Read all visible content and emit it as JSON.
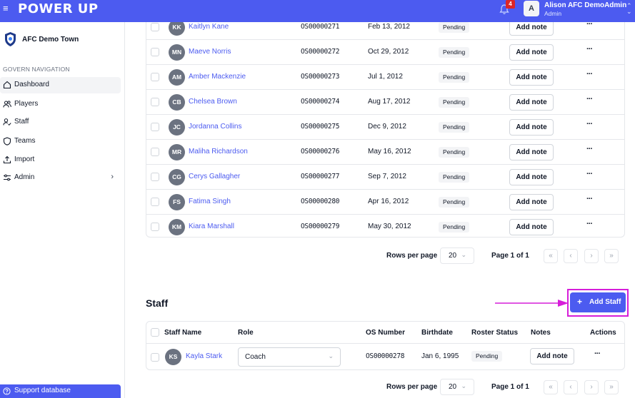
{
  "topbar": {
    "brand": "POWER UP",
    "notification_count": "4",
    "avatar_initial": "A",
    "user_name": "Alison AFC DemoAdmin",
    "user_role": "Admin"
  },
  "sidebar": {
    "org_name": "AFC Demo Town",
    "nav_heading": "GOVERN NAVIGATION",
    "items": [
      {
        "label": "Dashboard",
        "icon": "home-icon",
        "active": true
      },
      {
        "label": "Players",
        "icon": "users-icon"
      },
      {
        "label": "Staff",
        "icon": "user-check-icon"
      },
      {
        "label": "Teams",
        "icon": "shield-icon"
      },
      {
        "label": "Import",
        "icon": "upload-icon"
      },
      {
        "label": "Admin",
        "icon": "sliders-icon"
      }
    ],
    "support": "Support database"
  },
  "players_table": {
    "rows": [
      {
        "initials": "KK",
        "name": "Kaitlyn Kane",
        "os": "OS00000271",
        "dob": "Feb 13, 2012",
        "status": "Pending",
        "note": "Add note"
      },
      {
        "initials": "MN",
        "name": "Maeve Norris",
        "os": "OS00000272",
        "dob": "Oct 29, 2012",
        "status": "Pending",
        "note": "Add note"
      },
      {
        "initials": "AM",
        "name": "Amber Mackenzie",
        "os": "OS00000273",
        "dob": "Jul 1, 2012",
        "status": "Pending",
        "note": "Add note"
      },
      {
        "initials": "CB",
        "name": "Chelsea Brown",
        "os": "OS00000274",
        "dob": "Aug 17, 2012",
        "status": "Pending",
        "note": "Add note"
      },
      {
        "initials": "JC",
        "name": "Jordanna Collins",
        "os": "OS00000275",
        "dob": "Dec 9, 2012",
        "status": "Pending",
        "note": "Add note"
      },
      {
        "initials": "MR",
        "name": "Maliha Richardson",
        "os": "OS00000276",
        "dob": "May 16, 2012",
        "status": "Pending",
        "note": "Add note"
      },
      {
        "initials": "CG",
        "name": "Cerys Gallagher",
        "os": "OS00000277",
        "dob": "Sep 7, 2012",
        "status": "Pending",
        "note": "Add note"
      },
      {
        "initials": "FS",
        "name": "Fatima Singh",
        "os": "OS00000280",
        "dob": "Apr 16, 2012",
        "status": "Pending",
        "note": "Add note"
      },
      {
        "initials": "KM",
        "name": "Kiara Marshall",
        "os": "OS00000279",
        "dob": "May 30, 2012",
        "status": "Pending",
        "note": "Add note"
      }
    ],
    "pager": {
      "rows_label": "Rows per page",
      "rows_value": "20",
      "page_label": "Page 1 of 1"
    }
  },
  "staff": {
    "title": "Staff",
    "add_button": "Add Staff",
    "headers": {
      "name": "Staff Name",
      "role": "Role",
      "os": "OS Number",
      "dob": "Birthdate",
      "status": "Roster Status",
      "notes": "Notes",
      "actions": "Actions"
    },
    "row": {
      "initials": "KS",
      "name": "Kayla Stark",
      "role": "Coach",
      "os": "OS00000278",
      "dob": "Jan 6, 1995",
      "status": "Pending",
      "note": "Add note"
    },
    "pager": {
      "rows_label": "Rows per page",
      "rows_value": "20",
      "page_label": "Page 1 of 1"
    }
  },
  "colors": {
    "brand": "#4c5bf0",
    "annotation": "#d61ed9",
    "badge": "#dc2626"
  }
}
